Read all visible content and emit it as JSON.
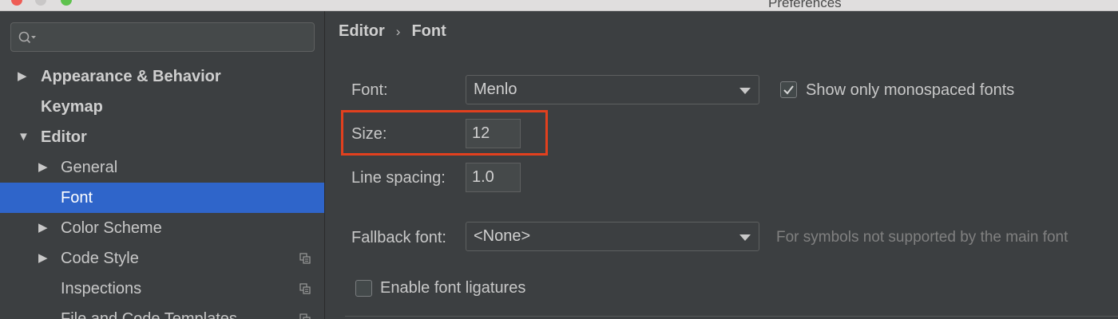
{
  "window": {
    "title": "Preferences",
    "buttons": {
      "close_color": "#ee5c55",
      "minimize_color": "#c9c7c7",
      "maximize_color": "#5fc24e"
    }
  },
  "sidebar": {
    "search": {
      "value": "",
      "icon": "search-icon"
    },
    "items": [
      {
        "label": "Appearance & Behavior",
        "expanded": false,
        "level": 0
      },
      {
        "label": "Keymap",
        "level": 0
      },
      {
        "label": "Editor",
        "expanded": true,
        "level": 0
      },
      {
        "label": "General",
        "expanded": false,
        "level": 1
      },
      {
        "label": "Font",
        "level": 1,
        "selected": true
      },
      {
        "label": "Color Scheme",
        "expanded": false,
        "level": 1
      },
      {
        "label": "Code Style",
        "expanded": false,
        "level": 1,
        "project_icon": "copy-icon"
      },
      {
        "label": "Inspections",
        "level": 1,
        "project_icon": "copy-icon"
      },
      {
        "label": "File and Code Templates",
        "level": 1,
        "project_icon": "copy-icon"
      }
    ],
    "selected_color": "#2f65ca"
  },
  "main": {
    "breadcrumb": {
      "parent": "Editor",
      "separator": "›",
      "current": "Font"
    },
    "font": {
      "label": "Font:",
      "value": "Menlo"
    },
    "monospaced": {
      "label": "Show only monospaced fonts",
      "checked": true
    },
    "size": {
      "label": "Size:",
      "value": "12"
    },
    "line_spacing": {
      "label": "Line spacing:",
      "value": "1.0"
    },
    "fallback": {
      "label": "Fallback font:",
      "value": "<None>",
      "hint": "For symbols not supported by the main font"
    },
    "ligatures": {
      "label": "Enable font ligatures",
      "checked": false
    },
    "highlight_color": "#e2401e"
  }
}
